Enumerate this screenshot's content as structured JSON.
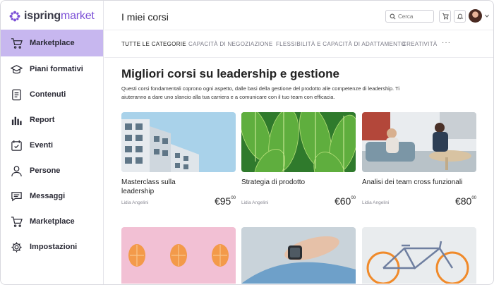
{
  "brand": {
    "name_part1": "ispring",
    "name_part2": "market"
  },
  "sidebar": {
    "items": [
      {
        "label": "Marketplace",
        "icon": "cart-icon",
        "active": true
      },
      {
        "label": "Piani formativi",
        "icon": "graduation-cap-icon"
      },
      {
        "label": "Contenuti",
        "icon": "document-icon"
      },
      {
        "label": "Report",
        "icon": "bar-chart-icon"
      },
      {
        "label": "Eventi",
        "icon": "calendar-check-icon"
      },
      {
        "label": "Persone",
        "icon": "person-icon"
      },
      {
        "label": "Messaggi",
        "icon": "chat-icon"
      },
      {
        "label": "Marketplace",
        "icon": "cart-icon"
      },
      {
        "label": "Impostazioni",
        "icon": "gear-icon"
      }
    ]
  },
  "header": {
    "title": "I miei corsi",
    "search_placeholder": "Cerca"
  },
  "tabs": [
    {
      "label": "TUTTE LE CATEGORIE",
      "active": true
    },
    {
      "label": "CAPACITÀ DI NEGOZIAZIONE"
    },
    {
      "label": "FLESSIBILITÀ E CAPACITÀ DI ADATTAMENTO"
    },
    {
      "label": "CREATIVITÀ"
    }
  ],
  "tabs_more": "···",
  "section": {
    "title": "Migliori corsi su leadership e gestione",
    "description": "Questi corsi fondamentali coprono ogni aspetto, dalle basi della gestione del prodotto alle competenze di leadership. Ti aiuteranno a dare uno slancio alla tua carriera e a comunicare con il tuo team con efficacia."
  },
  "courses": [
    {
      "title": "Masterclass sulla leadership",
      "author": "Lidia Angelini",
      "price": "€95",
      "cents": "00"
    },
    {
      "title": "Strategia di prodotto",
      "author": "Lidia Angelini",
      "price": "€60",
      "cents": "00"
    },
    {
      "title": "Analisi dei team cross funzionali",
      "author": "Lidia Angelini",
      "price": "€80",
      "cents": "00"
    }
  ],
  "colors": {
    "accent": "#7b4fd6",
    "active_nav_bg": "#c7b7ef"
  }
}
